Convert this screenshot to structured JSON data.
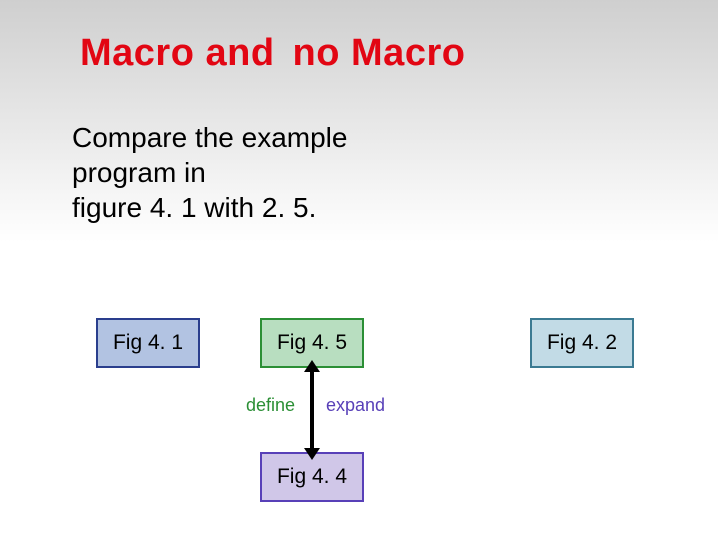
{
  "title_part1": "Macro and",
  "title_part2": "no Macro",
  "body_line1": "Compare the example",
  "body_line2": "program in",
  "body_line3": "figure 4. 1 with 2. 5.",
  "boxes": {
    "fig41": "Fig 4. 1",
    "fig45": "Fig 4. 5",
    "fig42": "Fig 4. 2",
    "fig44": "Fig 4. 4"
  },
  "labels": {
    "define": "define",
    "expand": "expand"
  },
  "colors": {
    "title": "#e20613",
    "define": "#2b8f35",
    "expand": "#5840b8"
  }
}
